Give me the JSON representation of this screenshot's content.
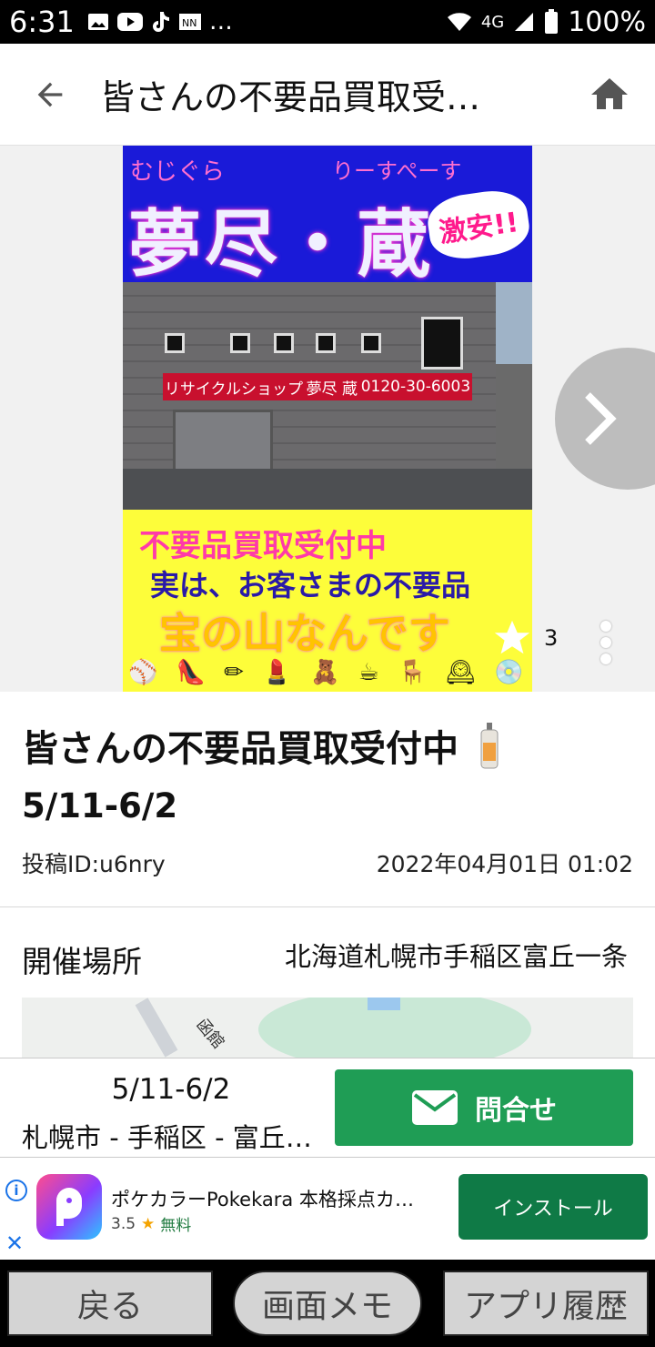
{
  "status_bar": {
    "time": "6:31",
    "network": "4G",
    "battery": "100%"
  },
  "header": {
    "title": "皆さんの不要品買取受…"
  },
  "poster": {
    "top_small_left": "むじぐら",
    "top_small_right": "りーすぺーす",
    "top_big": "夢尽・蔵",
    "badge": "激安!!",
    "sign_text_1": "リサイクルショップ",
    "sign_text_2": "夢尽 蔵",
    "sign_text_3": "0120-30-6003",
    "line1": "不要品買取受付中",
    "line2": "実は、お客さまの不要品",
    "line3": "宝の山なんです"
  },
  "gallery": {
    "favorite_count": "3"
  },
  "post": {
    "title": "皆さんの不要品買取受付中",
    "date_range": "5/11-6/2",
    "id": "投稿ID:u6nry",
    "posted_at": "2022年04月01日 01:02",
    "venue_label": "開催場所",
    "venue_value": "北海道札幌市手稲区富丘一条",
    "map_label": "函館"
  },
  "bottom_panel": {
    "date": "5/11-6/2",
    "location": "札幌市 - 手稲区 - 富丘一条",
    "inquire_label": "問合せ"
  },
  "ad": {
    "app_name": "ポケカラーPokekara 本格採点カラオケ",
    "rating": "3.5",
    "price": "無料",
    "install_label": "インストール",
    "info_label": "i",
    "close_label": "✕"
  },
  "nav": {
    "back": "戻る",
    "memo": "画面メモ",
    "history": "アプリ履歴"
  },
  "colors": {
    "accent_green": "#1f9d55",
    "ad_green": "#0f7a46",
    "poster_blue": "#1a1ad8",
    "poster_yellow": "#fdfd3a"
  }
}
